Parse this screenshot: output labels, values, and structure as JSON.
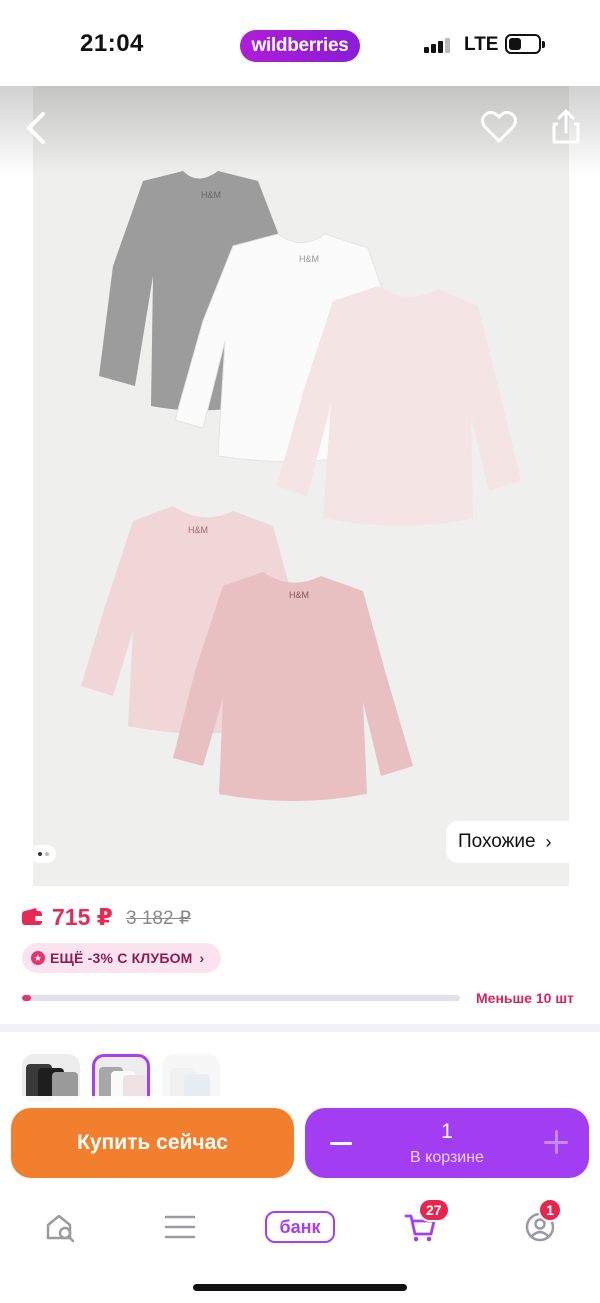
{
  "status_bar": {
    "time": "21:04",
    "brand": "wildberries",
    "network": "LTE",
    "icons": [
      "signal-bars-icon",
      "battery-icon"
    ]
  },
  "hero": {
    "icons": [
      "chevron-left-icon",
      "heart-icon",
      "share-icon"
    ],
    "similar_label": "Похожие",
    "similar_chevron": "›",
    "gallery_pages": 2,
    "gallery_active_page": 1
  },
  "price": {
    "current": "715 ₽",
    "old": "3 182 ₽",
    "wallet_icon": "wallet-icon",
    "club_badge": "ЕЩЁ -3% С КЛУБОМ",
    "club_chevron": "›",
    "stock_text": "Меньше 10 шт",
    "stock_level": 0.02
  },
  "variants": {
    "count_visible": 3,
    "selected_index": 1
  },
  "action_bar": {
    "buy_label": "Купить сейчас",
    "quantity": "1",
    "cart_caption": "В корзине"
  },
  "bottom_nav": {
    "items": [
      {
        "name": "home-search",
        "icon": "home-search-icon"
      },
      {
        "name": "catalog",
        "icon": "menu-icon"
      },
      {
        "name": "bank",
        "label": "банк"
      },
      {
        "name": "cart",
        "icon": "cart-icon",
        "badge": "27"
      },
      {
        "name": "profile",
        "icon": "profile-icon",
        "badge": "1"
      }
    ]
  },
  "colors": {
    "brand_purple": "#a73ef2",
    "price_red": "#e82953",
    "buy_orange": "#f17f2d",
    "badge_red": "#e8254f"
  }
}
